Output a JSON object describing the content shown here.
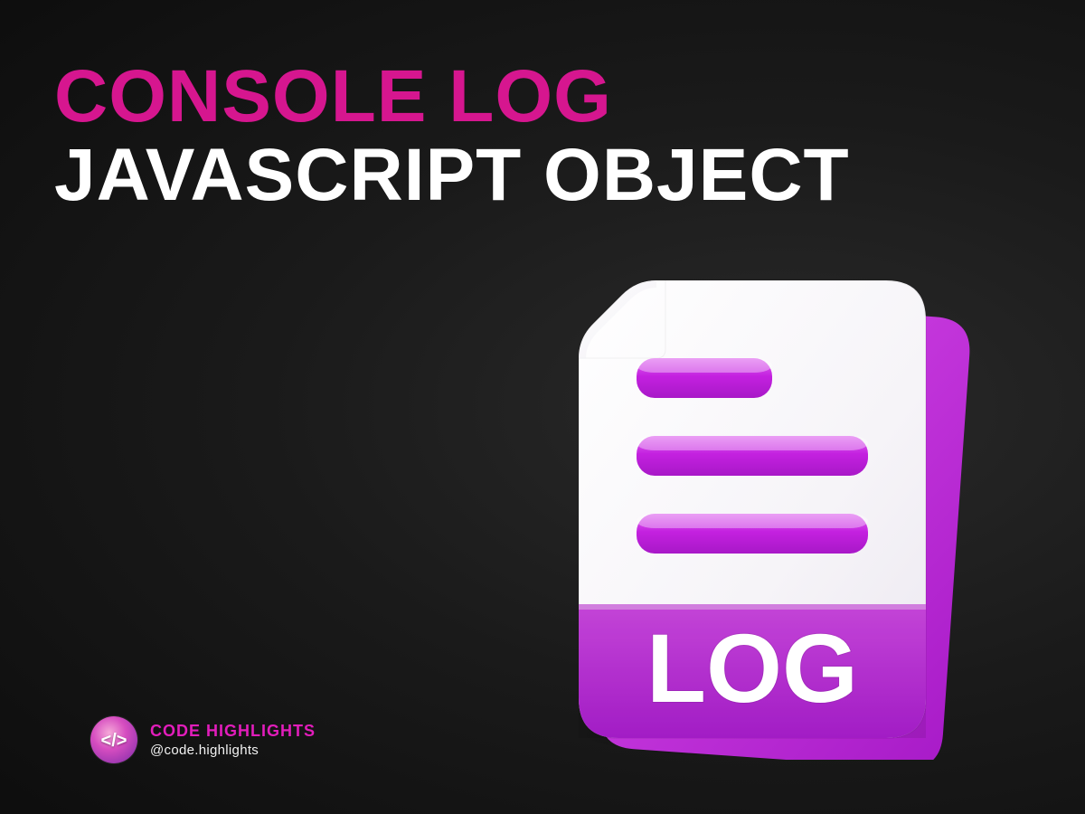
{
  "heading": {
    "line1": "CONSOLE LOG",
    "line2": "JAVASCRIPT OBJECT"
  },
  "file_icon": {
    "label": "LOG",
    "accent": "#c421e0",
    "accent_light": "#d94bea",
    "paper": "#f7f6f8"
  },
  "attribution": {
    "brand": "CODE HIGHLIGHTS",
    "handle": "@code.highlights",
    "avatar_glyph": "</>"
  }
}
